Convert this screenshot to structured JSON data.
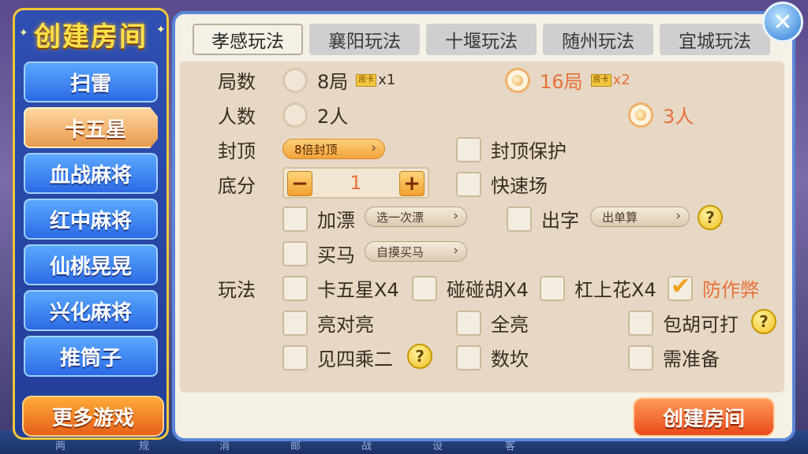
{
  "left": {
    "title": "创建房间",
    "items": [
      {
        "label": "扫雷"
      },
      {
        "label": "卡五星"
      },
      {
        "label": "血战麻将"
      },
      {
        "label": "红中麻将"
      },
      {
        "label": "仙桃晃晃"
      },
      {
        "label": "兴化麻将"
      },
      {
        "label": "推筒子"
      }
    ],
    "more_label": "更多游戏"
  },
  "tabs": [
    {
      "label": "孝感玩法"
    },
    {
      "label": "襄阳玩法"
    },
    {
      "label": "十堰玩法"
    },
    {
      "label": "随州玩法"
    },
    {
      "label": "宜城玩法"
    }
  ],
  "form": {
    "rounds_label": "局数",
    "round_options": [
      {
        "label": "8局",
        "ticket": "房卡",
        "count": "x1",
        "selected": false
      },
      {
        "label": "16局",
        "ticket": "房卡",
        "count": "x2",
        "selected": true
      }
    ],
    "players_label": "人数",
    "player_options": [
      {
        "label": "2人",
        "selected": false
      },
      {
        "label": "3人",
        "selected": true
      }
    ],
    "cap_label": "封顶",
    "cap_select": "8倍封顶",
    "cap_protect": {
      "label": "封顶保护",
      "checked": false
    },
    "base_label": "底分",
    "base_value": "1",
    "minus": "−",
    "plus": "+",
    "fast": {
      "label": "快速场",
      "checked": false
    },
    "float": {
      "label": "加漂",
      "checked": false
    },
    "float_select": "选一次漂",
    "chuzi": {
      "label": "出字",
      "checked": false
    },
    "chuzi_select": "出单算",
    "buyhorse": {
      "label": "买马",
      "checked": false
    },
    "buyhorse_select": "自摸买马",
    "play_label": "玩法",
    "play_options": [
      {
        "label": "卡五星X4",
        "checked": false
      },
      {
        "label": "碰碰胡X4",
        "checked": false
      },
      {
        "label": "杠上花X4",
        "checked": false
      },
      {
        "label": "防作弊",
        "checked": true
      },
      {
        "label": "亮对亮",
        "checked": false
      },
      {
        "label": "全亮",
        "checked": false
      },
      {
        "label": "包胡可打",
        "checked": false
      },
      {
        "label": "见四乘二",
        "checked": false
      },
      {
        "label": "数坎",
        "checked": false
      },
      {
        "label": "需准备",
        "checked": false
      }
    ],
    "help": "?"
  },
  "create_label": "创建房间",
  "close_label": "✕",
  "bottom_bar": [
    "两",
    "规",
    "消",
    "邮",
    "战",
    "设",
    "客"
  ]
}
